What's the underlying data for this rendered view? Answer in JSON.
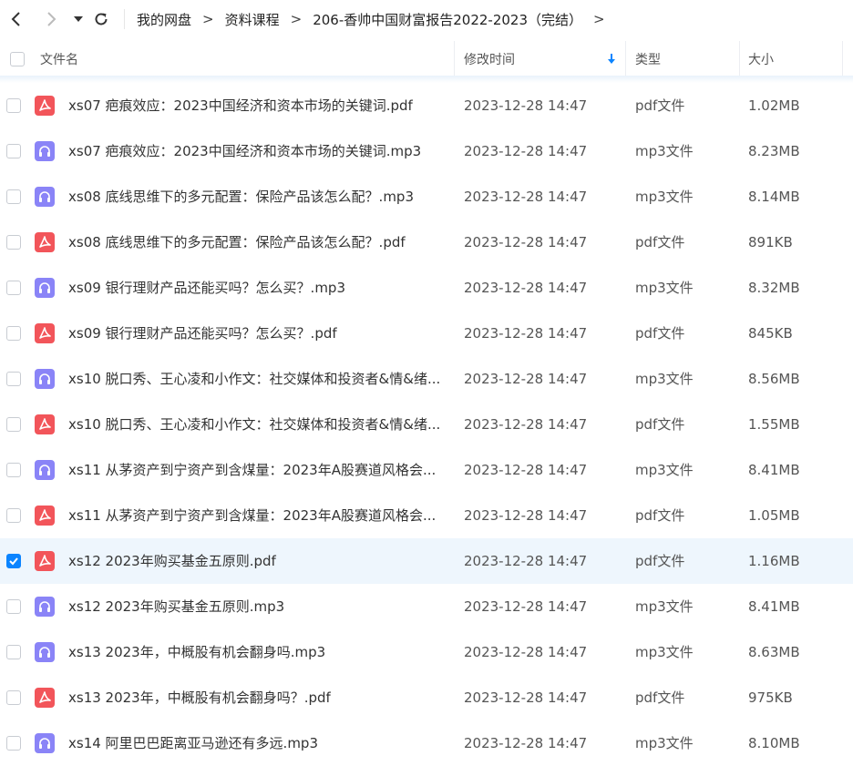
{
  "nav": {
    "back_icon": "chevron-left-icon",
    "forward_icon": "chevron-right-icon",
    "history_icon": "caret-down-icon",
    "refresh_icon": "refresh-icon",
    "breadcrumb": [
      "我的网盘",
      "资料课程",
      "206-香帅中国财富报告2022-2023（完结）"
    ],
    "separator": ">"
  },
  "header": {
    "name": "文件名",
    "modified": "修改时间",
    "type": "类型",
    "size": "大小",
    "sort_icon": "sort-down-icon"
  },
  "colors": {
    "accent": "#0b84ff",
    "pdf": "#f2555a",
    "mp3": "#8a84f7",
    "selected_row": "#eef6fd"
  },
  "files": [
    {
      "name": "xs07  疤痕效应：2023中国经济和资本市场的关键词.pdf",
      "date": "2023-12-28 14:47",
      "type": "pdf文件",
      "size": "1.02MB",
      "kind": "pdf",
      "checked": false
    },
    {
      "name": "xs07 疤痕效应：2023中国经济和资本市场的关键词.mp3",
      "date": "2023-12-28 14:47",
      "type": "mp3文件",
      "size": "8.23MB",
      "kind": "mp3",
      "checked": false
    },
    {
      "name": "xs08  底线思维下的多元配置：保险产品该怎么配？.mp3",
      "date": "2023-12-28 14:47",
      "type": "mp3文件",
      "size": "8.14MB",
      "kind": "mp3",
      "checked": false
    },
    {
      "name": "xs08  底线思维下的多元配置：保险产品该怎么配？.pdf",
      "date": "2023-12-28 14:47",
      "type": "pdf文件",
      "size": "891KB",
      "kind": "pdf",
      "checked": false
    },
    {
      "name": "xs09   银行理财产品还能买吗？怎么买？.mp3",
      "date": "2023-12-28 14:47",
      "type": "mp3文件",
      "size": "8.32MB",
      "kind": "mp3",
      "checked": false
    },
    {
      "name": "xs09  银行理财产品还能买吗？怎么买？.pdf",
      "date": "2023-12-28 14:47",
      "type": "pdf文件",
      "size": "845KB",
      "kind": "pdf",
      "checked": false
    },
    {
      "name": "xs10  脱口秀、王心凌和小作文：社交媒体和投资者&情&绪...",
      "date": "2023-12-28 14:47",
      "type": "mp3文件",
      "size": "8.56MB",
      "kind": "mp3",
      "checked": false
    },
    {
      "name": "xs10  脱口秀、王心凌和小作文：社交媒体和投资者&情&绪...",
      "date": "2023-12-28 14:47",
      "type": "pdf文件",
      "size": "1.55MB",
      "kind": "pdf",
      "checked": false
    },
    {
      "name": "xs11  从茅资产到宁资产到含煤量：2023年A股赛道风格会...",
      "date": "2023-12-28 14:47",
      "type": "mp3文件",
      "size": "8.41MB",
      "kind": "mp3",
      "checked": false
    },
    {
      "name": "xs11  从茅资产到宁资产到含煤量：2023年A股赛道风格会...",
      "date": "2023-12-28 14:47",
      "type": "pdf文件",
      "size": "1.05MB",
      "kind": "pdf",
      "checked": false
    },
    {
      "name": "xs12  2023年购买基金五原则.pdf",
      "date": "2023-12-28 14:47",
      "type": "pdf文件",
      "size": "1.16MB",
      "kind": "pdf",
      "checked": true
    },
    {
      "name": "xs12 2023年购买基金五原则.mp3",
      "date": "2023-12-28 14:47",
      "type": "mp3文件",
      "size": "8.41MB",
      "kind": "mp3",
      "checked": false
    },
    {
      "name": "xs13  2023年，中概股有机会翻身吗.mp3",
      "date": "2023-12-28 14:47",
      "type": "mp3文件",
      "size": "8.63MB",
      "kind": "mp3",
      "checked": false
    },
    {
      "name": "xs13  2023年，中概股有机会翻身吗？.pdf",
      "date": "2023-12-28 14:47",
      "type": "pdf文件",
      "size": "975KB",
      "kind": "pdf",
      "checked": false
    },
    {
      "name": "xs14  阿里巴巴距离亚马逊还有多远.mp3",
      "date": "2023-12-28 14:47",
      "type": "mp3文件",
      "size": "8.10MB",
      "kind": "mp3",
      "checked": false
    }
  ]
}
